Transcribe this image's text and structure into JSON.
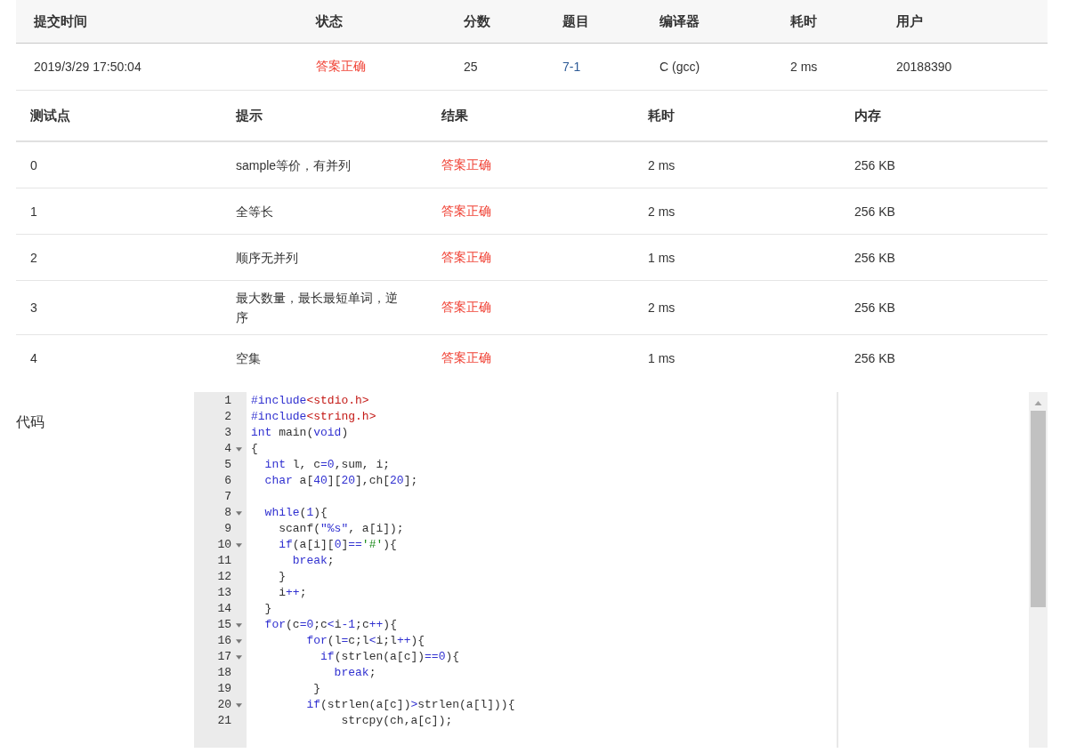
{
  "submission": {
    "columns": [
      "提交时间",
      "状态",
      "分数",
      "题目",
      "编译器",
      "耗时",
      "用户"
    ],
    "row": {
      "time": "2019/3/29 17:50:04",
      "status": {
        "text": "答案正确",
        "kind": "accepted"
      },
      "score": "25",
      "problem": "7-1",
      "compiler": "C (gcc)",
      "elapsed": "2 ms",
      "user": "20188390"
    }
  },
  "tests": {
    "columns": [
      "测试点",
      "提示",
      "结果",
      "耗时",
      "内存"
    ],
    "rows": [
      {
        "case": "0",
        "hint": "sample等价，有并列",
        "result": {
          "text": "答案正确",
          "kind": "accepted"
        },
        "elapsed": "2 ms",
        "memory": "256 KB"
      },
      {
        "case": "1",
        "hint": "全等长",
        "result": {
          "text": "答案正确",
          "kind": "accepted"
        },
        "elapsed": "2 ms",
        "memory": "256 KB"
      },
      {
        "case": "2",
        "hint": "顺序无并列",
        "result": {
          "text": "答案正确",
          "kind": "accepted"
        },
        "elapsed": "1 ms",
        "memory": "256 KB"
      },
      {
        "case": "3",
        "hint": "最大数量，最长最短单词，逆序",
        "result": {
          "text": "答案正确",
          "kind": "accepted"
        },
        "elapsed": "2 ms",
        "memory": "256 KB"
      },
      {
        "case": "4",
        "hint": "空集",
        "result": {
          "text": "答案正确",
          "kind": "accepted"
        },
        "elapsed": "1 ms",
        "memory": "256 KB"
      }
    ]
  },
  "code": {
    "label": "代码",
    "lines": [
      {
        "number": "1",
        "foldable": false,
        "tokens": [
          {
            "kind": "keyword",
            "text": "#include"
          },
          {
            "kind": "header",
            "text": "<stdio.h>"
          }
        ]
      },
      {
        "number": "2",
        "foldable": false,
        "tokens": [
          {
            "kind": "keyword",
            "text": "#include"
          },
          {
            "kind": "header",
            "text": "<string.h>"
          }
        ]
      },
      {
        "number": "3",
        "foldable": false,
        "tokens": [
          {
            "kind": "keyword",
            "text": "int"
          },
          {
            "kind": "plain",
            "text": " main("
          },
          {
            "kind": "keyword",
            "text": "void"
          },
          {
            "kind": "plain",
            "text": ")"
          }
        ]
      },
      {
        "number": "4",
        "foldable": true,
        "tokens": [
          {
            "kind": "plain",
            "text": "{"
          }
        ]
      },
      {
        "number": "5",
        "foldable": false,
        "tokens": [
          {
            "kind": "keyword",
            "text": "  int"
          },
          {
            "kind": "plain",
            "text": " l, c"
          },
          {
            "kind": "operator",
            "text": "="
          },
          {
            "kind": "number",
            "text": "0"
          },
          {
            "kind": "plain",
            "text": ",sum, i;"
          }
        ]
      },
      {
        "number": "6",
        "foldable": false,
        "tokens": [
          {
            "kind": "keyword",
            "text": "  char"
          },
          {
            "kind": "plain",
            "text": " a["
          },
          {
            "kind": "number",
            "text": "40"
          },
          {
            "kind": "plain",
            "text": "]["
          },
          {
            "kind": "number",
            "text": "20"
          },
          {
            "kind": "plain",
            "text": "],ch["
          },
          {
            "kind": "number",
            "text": "20"
          },
          {
            "kind": "plain",
            "text": "];"
          }
        ]
      },
      {
        "number": "7",
        "foldable": false
      },
      {
        "number": "8",
        "foldable": true,
        "tokens": [
          {
            "kind": "keyword",
            "text": "  while"
          },
          {
            "kind": "plain",
            "text": "("
          },
          {
            "kind": "number",
            "text": "1"
          },
          {
            "kind": "plain",
            "text": "){"
          }
        ]
      },
      {
        "number": "9",
        "foldable": false,
        "tokens": [
          {
            "kind": "plain",
            "text": "    scanf("
          },
          {
            "kind": "string",
            "text": "\"%s\""
          },
          {
            "kind": "plain",
            "text": ", a[i]);"
          }
        ]
      },
      {
        "number": "10",
        "foldable": true,
        "tokens": [
          {
            "kind": "keyword",
            "text": "    if"
          },
          {
            "kind": "plain",
            "text": "(a[i]["
          },
          {
            "kind": "number",
            "text": "0"
          },
          {
            "kind": "plain",
            "text": "]"
          },
          {
            "kind": "operator",
            "text": "=="
          },
          {
            "kind": "char",
            "text": "'#'"
          },
          {
            "kind": "plain",
            "text": "){"
          }
        ]
      },
      {
        "number": "11",
        "foldable": false,
        "tokens": [
          {
            "kind": "keyword",
            "text": "      break"
          },
          {
            "kind": "plain",
            "text": ";"
          }
        ]
      },
      {
        "number": "12",
        "foldable": false,
        "tokens": [
          {
            "kind": "plain",
            "text": "    }"
          }
        ]
      },
      {
        "number": "13",
        "foldable": false,
        "tokens": [
          {
            "kind": "plain",
            "text": "    i"
          },
          {
            "kind": "operator",
            "text": "++"
          },
          {
            "kind": "plain",
            "text": ";"
          }
        ]
      },
      {
        "number": "14",
        "foldable": false,
        "tokens": [
          {
            "kind": "plain",
            "text": "  }"
          }
        ]
      },
      {
        "number": "15",
        "foldable": true,
        "tokens": [
          {
            "kind": "keyword",
            "text": "  for"
          },
          {
            "kind": "plain",
            "text": "(c"
          },
          {
            "kind": "operator",
            "text": "="
          },
          {
            "kind": "number",
            "text": "0"
          },
          {
            "kind": "plain",
            "text": ";c"
          },
          {
            "kind": "operator",
            "text": "<"
          },
          {
            "kind": "plain",
            "text": "i"
          },
          {
            "kind": "operator",
            "text": "-"
          },
          {
            "kind": "number",
            "text": "1"
          },
          {
            "kind": "plain",
            "text": ";c"
          },
          {
            "kind": "operator",
            "text": "++"
          },
          {
            "kind": "plain",
            "text": "){"
          }
        ]
      },
      {
        "number": "16",
        "foldable": true,
        "tokens": [
          {
            "kind": "keyword",
            "text": "        for"
          },
          {
            "kind": "plain",
            "text": "(l"
          },
          {
            "kind": "operator",
            "text": "="
          },
          {
            "kind": "plain",
            "text": "c;l"
          },
          {
            "kind": "operator",
            "text": "<"
          },
          {
            "kind": "plain",
            "text": "i;l"
          },
          {
            "kind": "operator",
            "text": "++"
          },
          {
            "kind": "plain",
            "text": "){"
          }
        ]
      },
      {
        "number": "17",
        "foldable": true,
        "tokens": [
          {
            "kind": "keyword",
            "text": "          if"
          },
          {
            "kind": "plain",
            "text": "(strlen(a[c])"
          },
          {
            "kind": "operator",
            "text": "=="
          },
          {
            "kind": "number",
            "text": "0"
          },
          {
            "kind": "plain",
            "text": "){"
          }
        ]
      },
      {
        "number": "18",
        "foldable": false,
        "tokens": [
          {
            "kind": "keyword",
            "text": "            break"
          },
          {
            "kind": "plain",
            "text": ";"
          }
        ]
      },
      {
        "number": "19",
        "foldable": false,
        "tokens": [
          {
            "kind": "plain",
            "text": "         }"
          }
        ]
      },
      {
        "number": "20",
        "foldable": true,
        "tokens": [
          {
            "kind": "keyword",
            "text": "        if"
          },
          {
            "kind": "plain",
            "text": "(strlen(a[c])"
          },
          {
            "kind": "operator",
            "text": ">"
          },
          {
            "kind": "plain",
            "text": "strlen(a[l])){"
          }
        ]
      },
      {
        "number": "21",
        "foldable": false,
        "tokens": [
          {
            "kind": "plain",
            "text": "             strcpy(ch,a[c]);"
          }
        ]
      }
    ]
  }
}
